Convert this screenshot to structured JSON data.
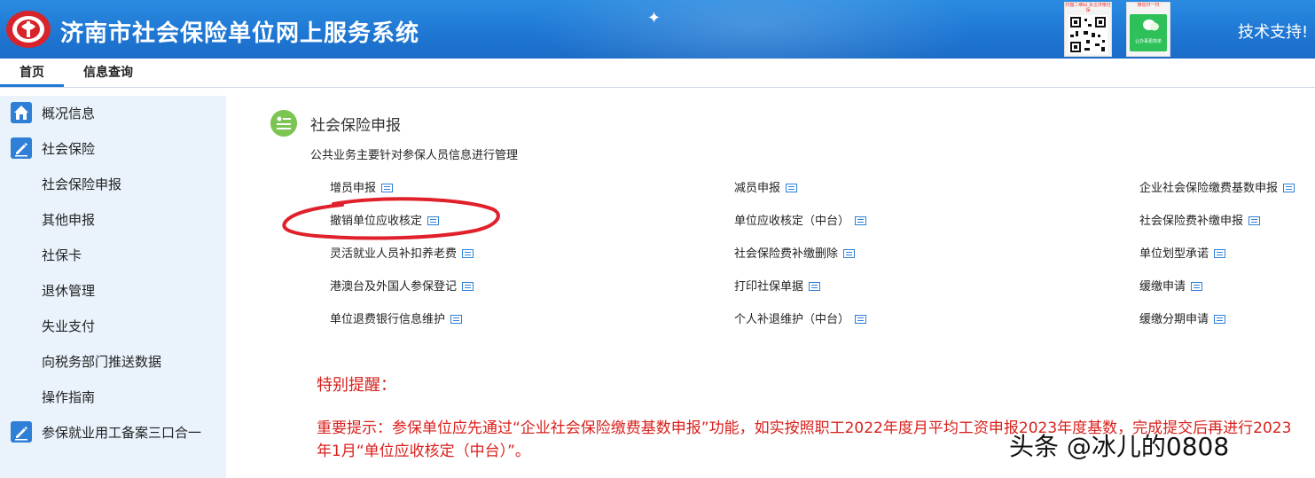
{
  "header": {
    "title": "济南市社会保险单位网上服务系统",
    "tech_support": "技术支持!",
    "qr1_caption": "扫描二维码 关注济南社保",
    "qr2_caption": "微信扫一扫",
    "qr2_sub": "让办事更简单"
  },
  "nav": {
    "tabs": [
      "首页",
      "信息查询"
    ]
  },
  "sidebar": {
    "items": [
      "概况信息",
      "社会保险",
      "社会保险申报",
      "其他申报",
      "社保卡",
      "退休管理",
      "失业支付",
      "向税务部门推送数据",
      "操作指南",
      "参保就业用工备案三口合一"
    ]
  },
  "main": {
    "title": "社会保险申报",
    "description": "公共业务主要针对参保人员信息进行管理",
    "services": [
      [
        "增员申报",
        "减员申报",
        "企业社会保险缴费基数申报"
      ],
      [
        "撤销单位应收核定",
        "单位应收核定（中台）",
        "社会保险费补缴申报"
      ],
      [
        "灵活就业人员补扣养老费",
        "社会保险费补缴删除",
        "单位划型承诺"
      ],
      [
        "港澳台及外国人参保登记",
        "打印社保单据",
        "缓缴申请"
      ],
      [
        "单位退费银行信息维护",
        "个人补退维护（中台）",
        "缓缴分期申请"
      ]
    ],
    "reminder_title": "特别提醒：",
    "reminder_text": "重要提示：参保单位应先通过“企业社会保险缴费基数申报”功能，如实按照职工2022年度月平均工资申报2023年度基数，完成提交后再进行2023年1月“单位应收核定（中台）”。",
    "watermark": "头条 @冰儿的0808"
  },
  "colors": {
    "banner": "#1f78d4",
    "sidebar_bg": "#eaf3fc",
    "reminder": "#d9201c",
    "annotation": "#e0202a",
    "section_icon": "#7cc552"
  }
}
